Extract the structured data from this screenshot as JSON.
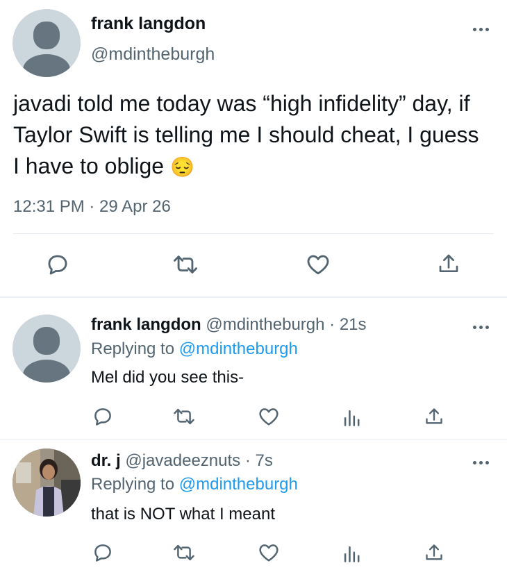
{
  "main_tweet": {
    "display_name": "frank langdon",
    "handle": "@mdintheburgh",
    "text": "javadi told me today was “high infidelity” day, if Taylor Swift is telling me I should cheat, I guess I have to oblige",
    "emoji": "😔",
    "timestamp": "12:31 PM · 29 Apr 26"
  },
  "replies": [
    {
      "display_name": "frank langdon",
      "handle": "@mdintheburgh",
      "time": "· 21s",
      "replying_label": "Replying to",
      "replying_to": "@mdintheburgh",
      "text": "Mel did you see this-"
    },
    {
      "display_name": "dr. j",
      "handle": "@javadeeznuts",
      "time": "· 7s",
      "replying_label": "Replying to",
      "replying_to": "@mdintheburgh",
      "text": "that is NOT what I meant"
    }
  ],
  "icons": {
    "reply": "reply-icon",
    "retweet": "retweet-icon",
    "like": "heart-icon",
    "analytics": "analytics-icon",
    "share": "share-icon",
    "more": "more-icon"
  },
  "colors": {
    "link": "#1d9bf0",
    "muted": "#536471",
    "divider": "#e6ecf0"
  }
}
